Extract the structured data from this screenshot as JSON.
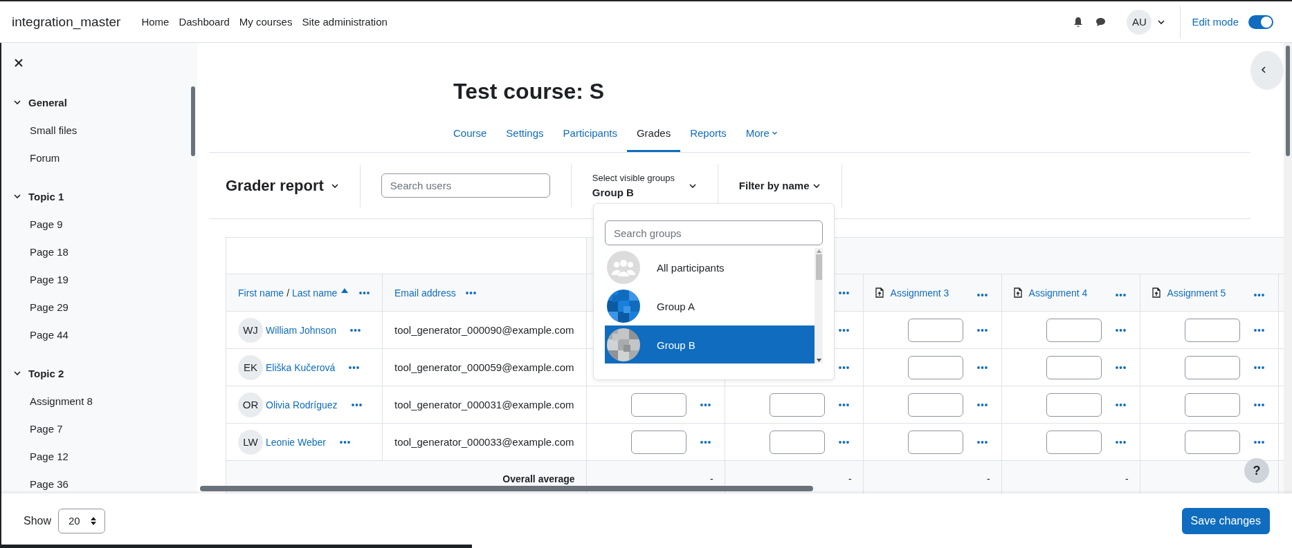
{
  "navbar": {
    "brand": "integration_master",
    "links": [
      "Home",
      "Dashboard",
      "My courses",
      "Site administration"
    ],
    "avatar": "AU",
    "edit_mode": {
      "label": "Edit mode",
      "on": true
    }
  },
  "sidebar": {
    "sections": [
      {
        "title": "General",
        "expanded": true,
        "items": [
          "Small files",
          "Forum"
        ]
      },
      {
        "title": "Topic 1",
        "expanded": true,
        "items": [
          "Page 9",
          "Page 18",
          "Page 19",
          "Page 29",
          "Page 44"
        ]
      },
      {
        "title": "Topic 2",
        "expanded": true,
        "items": [
          "Assignment 8",
          "Page 7",
          "Page 12",
          "Page 36"
        ]
      }
    ]
  },
  "course": {
    "title": "Test course: S",
    "tabs": [
      {
        "label": "Course",
        "selected": false
      },
      {
        "label": "Settings",
        "selected": false
      },
      {
        "label": "Participants",
        "selected": false
      },
      {
        "label": "Grades",
        "selected": true
      },
      {
        "label": "Reports",
        "selected": false
      },
      {
        "label": "More",
        "selected": false
      }
    ]
  },
  "toolbar": {
    "report": "Grader report",
    "search": {
      "placeholder": "Search users"
    },
    "groups": {
      "label": "Select visible groups",
      "value": "Group B"
    },
    "filter": "Filter by name"
  },
  "group_menu": {
    "search": {
      "placeholder": "Search groups"
    },
    "items": [
      {
        "label": "All participants",
        "kind": "everyone",
        "selected": false
      },
      {
        "label": "Group A",
        "kind": "picture",
        "selected": false
      },
      {
        "label": "Group B",
        "kind": "picture",
        "selected": true
      }
    ]
  },
  "table": {
    "name_column": {
      "first": "First name",
      "separator": "/",
      "last": "Last name",
      "sorted": true
    },
    "email_column": "Email address",
    "grade_columns": [
      {
        "kind": "covered"
      },
      {
        "kind": "menu"
      },
      {
        "kind": "assignment",
        "label": "Assignment 3"
      },
      {
        "kind": "assignment",
        "label": "Assignment 4"
      },
      {
        "kind": "assignment",
        "label": "Assignment 5"
      }
    ],
    "rows": [
      {
        "initials": "WJ",
        "name": "William Johnson",
        "email": "tool_generator_000090@example.com",
        "grades": [
          {
            "kind": "covered"
          },
          {
            "kind": "menu"
          },
          {
            "kind": "field"
          },
          {
            "kind": "field"
          },
          {
            "kind": "field"
          }
        ]
      },
      {
        "initials": "EK",
        "name": "Eliška Kučerová",
        "email": "tool_generator_000059@example.com",
        "grades": [
          {
            "kind": "covered"
          },
          {
            "kind": "menu"
          },
          {
            "kind": "field"
          },
          {
            "kind": "field"
          },
          {
            "kind": "field"
          }
        ]
      },
      {
        "initials": "OR",
        "name": "Olivia Rodríguez",
        "email": "tool_generator_000031@example.com",
        "grades": [
          {
            "kind": "field"
          },
          {
            "kind": "field"
          },
          {
            "kind": "field"
          },
          {
            "kind": "field"
          },
          {
            "kind": "field"
          }
        ]
      },
      {
        "initials": "LW",
        "name": "Leonie Weber",
        "email": "tool_generator_000033@example.com",
        "grades": [
          {
            "kind": "field"
          },
          {
            "kind": "field"
          },
          {
            "kind": "field"
          },
          {
            "kind": "field"
          },
          {
            "kind": "field"
          }
        ]
      }
    ],
    "average": {
      "label": "Overall average",
      "values": [
        "-",
        "-",
        "-",
        "-"
      ]
    }
  },
  "help": "?",
  "footer": {
    "show_label": "Show",
    "per_page": "20",
    "save": "Save changes"
  }
}
